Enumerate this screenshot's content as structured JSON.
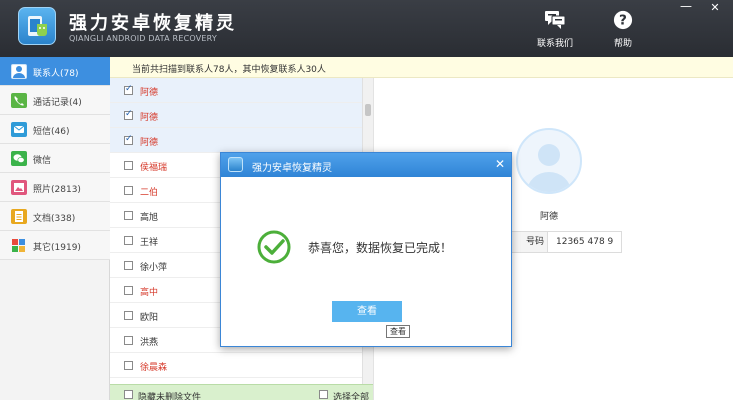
{
  "header": {
    "title": "强力安卓恢复精灵",
    "subtitle": "QIANGLI ANDROID DATA RECOVERY",
    "contact_label": "联系我们",
    "help_label": "帮助",
    "minimize_glyph": "—",
    "close_glyph": "✕"
  },
  "sidebar": {
    "items": [
      {
        "label": "联系人(78)",
        "icon": "contacts-icon",
        "color": "#ffffff"
      },
      {
        "label": "通话记录(4)",
        "icon": "phone-icon",
        "color": "#5ab545"
      },
      {
        "label": "短信(46)",
        "icon": "sms-icon",
        "color": "#2f9bd8"
      },
      {
        "label": "微信",
        "icon": "wechat-icon",
        "color": "#3bb34a"
      },
      {
        "label": "照片(2813)",
        "icon": "photo-icon",
        "color": "#e0567d"
      },
      {
        "label": "文档(338)",
        "icon": "document-icon",
        "color": "#e8a81f"
      },
      {
        "label": "其它(1919)",
        "icon": "other-icon",
        "color": "#f0b437"
      }
    ]
  },
  "notice": "当前共扫描到联系人78人，其中恢复联系人30人",
  "contacts": [
    {
      "name": "阿德",
      "checked": true,
      "deleted": true
    },
    {
      "name": "阿德",
      "checked": true,
      "deleted": true
    },
    {
      "name": "阿德",
      "checked": true,
      "deleted": true
    },
    {
      "name": "侯福瑞",
      "checked": false,
      "deleted": true
    },
    {
      "name": "二伯",
      "checked": false,
      "deleted": true
    },
    {
      "name": "高旭",
      "checked": false,
      "deleted": false
    },
    {
      "name": "王祥",
      "checked": false,
      "deleted": false
    },
    {
      "name": "徐小萍",
      "checked": false,
      "deleted": false
    },
    {
      "name": "高中",
      "checked": false,
      "deleted": true
    },
    {
      "name": "欧阳",
      "checked": false,
      "deleted": false
    },
    {
      "name": "洪燕",
      "checked": false,
      "deleted": false
    },
    {
      "name": "徐晨森",
      "checked": false,
      "deleted": true
    }
  ],
  "bottom_bar": {
    "hide_undeleted_label": "隐藏未删除文件",
    "select_all_label": "选择全部"
  },
  "detail": {
    "name": "阿德",
    "phone_key": "号码",
    "phone_value": "12365 478 9"
  },
  "dialog": {
    "title": "强力安卓恢复精灵",
    "message": "恭喜您，数据恢复已完成！",
    "button_label": "查看",
    "tooltip": "查看",
    "close_glyph": "✕"
  },
  "colors": {
    "header_bg": "#2e3238",
    "accent": "#3d8fe0",
    "deleted_text": "#d63a2b",
    "success": "#4caf3a"
  }
}
